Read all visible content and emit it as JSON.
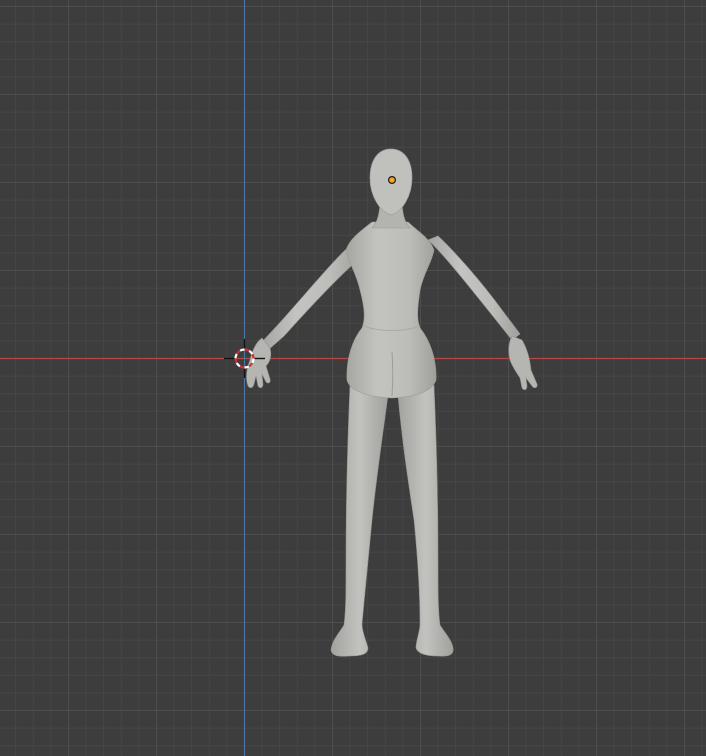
{
  "viewport": {
    "background_color": "#3d3d3d",
    "grid_minor_color": "#474747",
    "grid_major_color": "#4e4e4e",
    "x_axis_color": "#c04a4a",
    "y_axis_color": "#4a73a6"
  },
  "scene": {
    "object": {
      "type": "human-figure-mesh",
      "pose": "a-pose",
      "view": "back",
      "color": "#b9bab6",
      "selected": false
    },
    "origin_point_color": "#f5a623",
    "cursor_3d": {
      "icon": "3d-cursor-icon",
      "ring_colors": [
        "#ffffff",
        "#d03030"
      ]
    }
  }
}
